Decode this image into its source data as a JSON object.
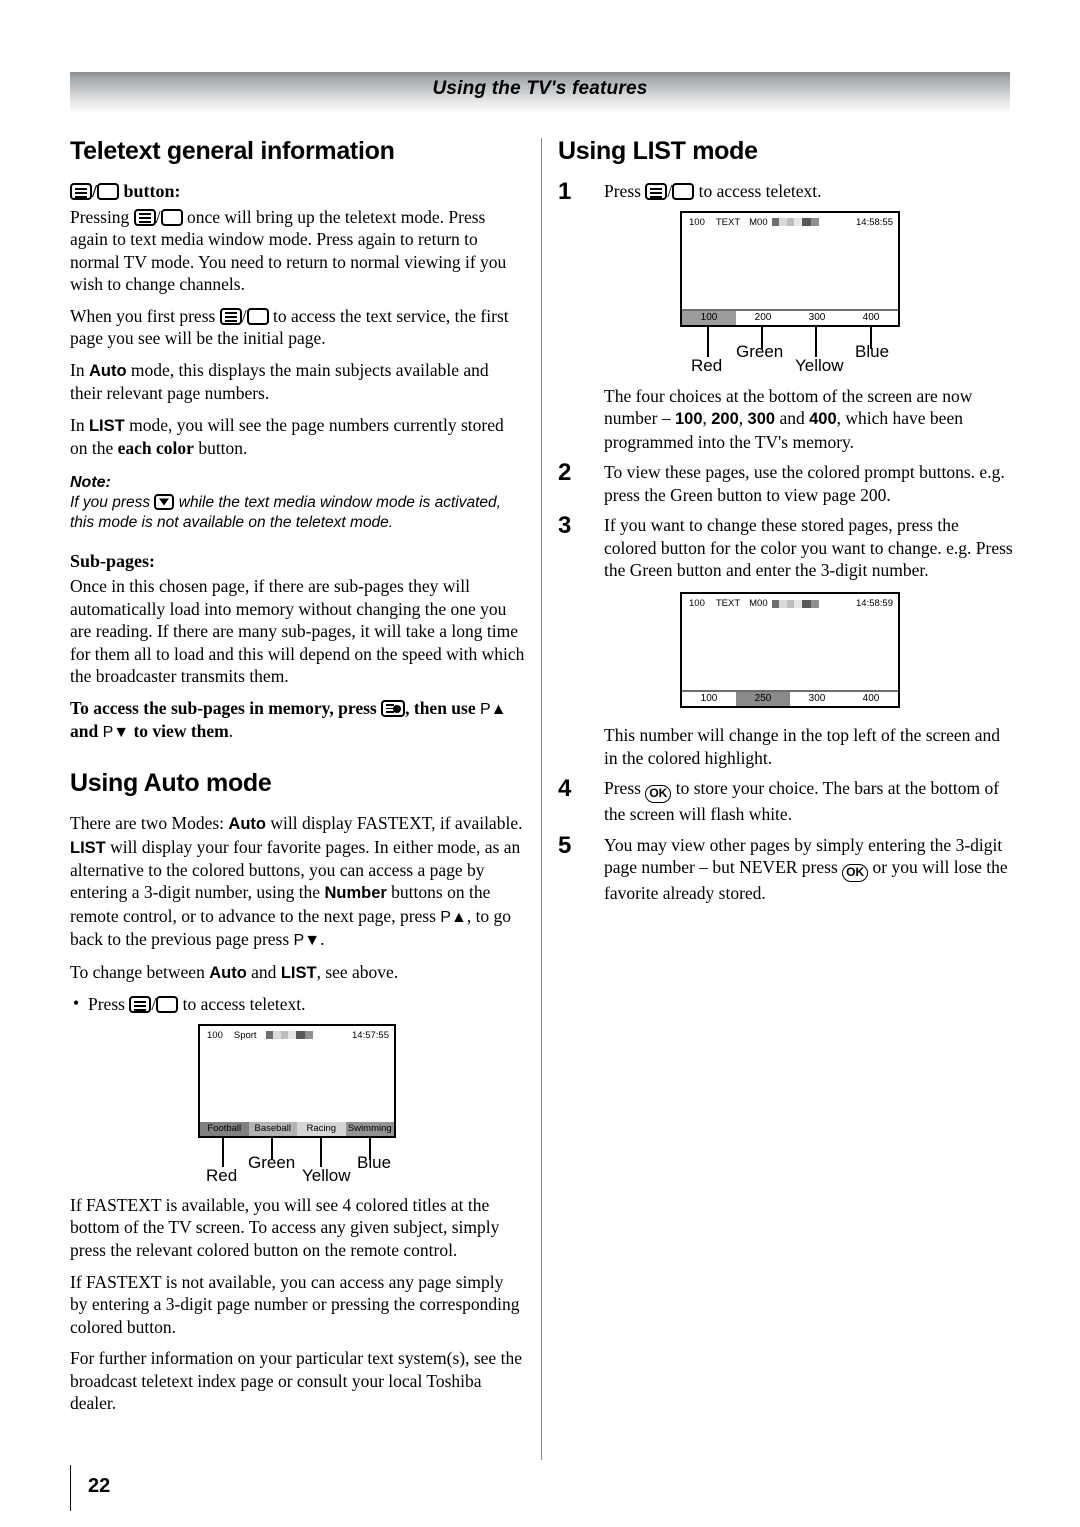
{
  "header": {
    "title": "Using the TV's features"
  },
  "footer": {
    "page_number": "22"
  },
  "left_column": {
    "section1_title": "Teletext general information",
    "button_heading_suffix": "button:",
    "paragraphs": {
      "p1_a": "Pressing ",
      "p1_b": " once will bring up the teletext mode. Press again to text media window mode. Press again to return to normal TV mode. You need to return to normal viewing if you wish to change channels.",
      "p2_a": "When you first press ",
      "p2_b": " to access the text service, the first page you see will be the initial page.",
      "p3_a": "In ",
      "p3_bold": "Auto",
      "p3_b": " mode, this displays the main subjects available and their relevant page numbers.",
      "p4_a": "In ",
      "p4_bold": "LIST",
      "p4_b": " mode, you will see the page numbers currently stored on the ",
      "p4_bold2": "each color",
      "p4_c": " button."
    },
    "note": {
      "title": "Note:",
      "text_a": "If you press ",
      "text_b": " while the text media window mode is activated, this mode is not available on the teletext mode."
    },
    "subpages": {
      "heading": "Sub-pages:",
      "body": "Once in this chosen page, if there are sub-pages they will automatically load into memory without changing the one you are reading. If there are many sub-pages, it will take a long time for them all to load and this will depend on the speed with which the broadcaster transmits them.",
      "bold_a": "To access the sub-pages in memory, press ",
      "bold_b": ", then use ",
      "bold_p_up": "P▲",
      "bold_c": " and ",
      "bold_p_dn": "P▼",
      "bold_d": " to view them",
      "bold_e": "."
    },
    "section2_title": "Using Auto mode",
    "auto": {
      "p1_a": "There are two Modes: ",
      "p1_auto": "Auto",
      "p1_b": " will display FASTEXT, if available. ",
      "p1_list": "LIST",
      "p1_c": " will display your four favorite pages. In either mode, as an alternative to the colored buttons, you can access a page by entering a 3-digit number, using the ",
      "p1_number": "Number",
      "p1_d": " buttons on the remote control, or to advance to the next page, press ",
      "p1_pup": "P▲",
      "p1_e": ", to go back to the previous page press ",
      "p1_pdn": "P▼",
      "p1_f": ".",
      "p2_a": "To change between ",
      "p2_auto": "Auto",
      "p2_b": " and ",
      "p2_list": "LIST",
      "p2_c": ", see above.",
      "bullet_a": "Press ",
      "bullet_b": " to access teletext.",
      "p3": "If FASTEXT is available, you will see 4 colored titles at the bottom of the TV screen. To access any given subject, simply press the relevant colored button on the remote control.",
      "p4": "If FASTEXT is not available, you can access any page simply by entering a 3-digit page number or pressing the corresponding colored button.",
      "p5": "For further information on your particular text system(s), see the broadcast teletext index page or consult your local Toshiba dealer."
    },
    "tv_diagram": {
      "status_page": "100",
      "status_label": "Sport",
      "status_clock": "14:57:55",
      "bar_items": [
        "Football",
        "Baseball",
        "Racing",
        "Swimming"
      ],
      "bar_colors": [
        "#808080",
        "#b3b3b3",
        "#d6d6d6",
        "#949494"
      ],
      "color_labels": [
        "Red",
        "Green",
        "Yellow",
        "Blue"
      ]
    }
  },
  "right_column": {
    "section_title": "Using LIST mode",
    "steps": [
      {
        "num": "1",
        "text_a": "Press ",
        "text_b": " to access teletext."
      },
      {
        "num": "2",
        "text": "To view these pages, use the colored prompt buttons. e.g. press the Green button to view page 200."
      },
      {
        "num": "3",
        "text": "If you want to change these stored pages, press the colored button for the color you want to change. e.g. Press the Green button and enter the 3-digit number."
      },
      {
        "num": "4",
        "text_a": "Press ",
        "text_b": " to store your choice. The bars at the bottom of the screen will flash white."
      },
      {
        "num": "5",
        "text_a": "You may view other pages by simply entering the 3-digit page number – but NEVER press ",
        "text_b": " or you will lose the favorite already stored."
      }
    ],
    "after_diagram1": {
      "a": "The four choices at the bottom of the screen are now number – ",
      "b1": "100",
      "s1": ", ",
      "b2": "200",
      "s2": ", ",
      "b3": "300",
      "s3": " and ",
      "b4": "400",
      "c": ", which have been programmed into the TV's memory."
    },
    "after_diagram2": "This number will change in the top left of the screen and in the colored highlight.",
    "tv_diagram1": {
      "status_page": "100",
      "status_label": "TEXT",
      "status_mode": "M00",
      "status_clock": "14:58:55",
      "bar_items": [
        "100",
        "200",
        "300",
        "400"
      ],
      "highlight_index": 0,
      "highlight_color": "#9c9c9c",
      "color_labels": [
        "Red",
        "Green",
        "Yellow",
        "Blue"
      ]
    },
    "tv_diagram2": {
      "status_page": "100",
      "status_label": "TEXT",
      "status_mode": "M00",
      "status_clock": "14:58:59",
      "bar_items": [
        "100",
        "250",
        "300",
        "400"
      ],
      "highlight_index": 1,
      "highlight_color": "#8a8a8a"
    }
  },
  "icons": {
    "menu": "teletext-menu-icon",
    "blank": "blank-key-icon",
    "menu_dot": "subpage-icon",
    "down": "down-arrow-key-icon",
    "ok": "OK"
  },
  "status_block_colors": [
    "#6e6e6e",
    "#d9d9d9",
    "#bdbdbd",
    "#e5e5e5",
    "#585858",
    "#8f8f8f"
  ]
}
